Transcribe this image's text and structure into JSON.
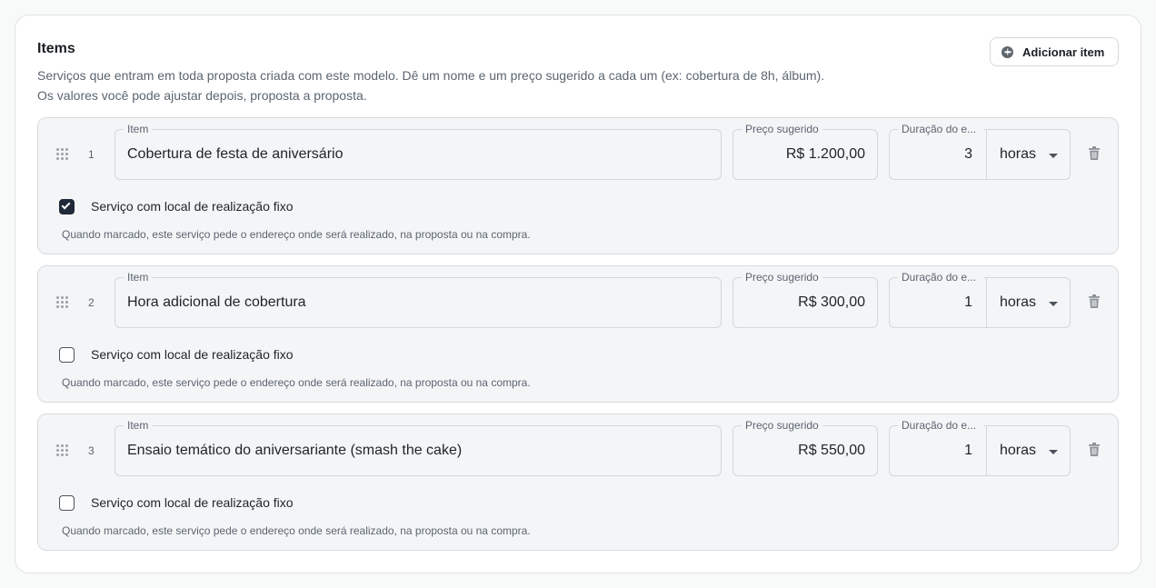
{
  "header": {
    "title": "Items",
    "description_line1": "Serviços que entram em toda proposta criada com este modelo. Dê um nome e um preço sugerido a cada um (ex: cobertura de 8h, álbum).",
    "description_line2": "Os valores você pode ajustar depois, proposta a proposta.",
    "add_button_label": "Adicionar item",
    "add_button_icon": "plus-circle-icon"
  },
  "labels": {
    "item": "Item",
    "price": "Preço sugerido",
    "duration": "Duração do e...",
    "fixed_location": "Serviço com local de realização fixo",
    "fixed_location_hint": "Quando marcado, este serviço pede o endereço onde será realizado, na proposta ou na compra."
  },
  "items": [
    {
      "number": "1",
      "name": "Cobertura de festa de aniversário",
      "price": "R$ 1.200,00",
      "duration": "3",
      "unit": "horas",
      "fixed_location": true
    },
    {
      "number": "2",
      "name": "Hora adicional de cobertura",
      "price": "R$ 300,00",
      "duration": "1",
      "unit": "horas",
      "fixed_location": false
    },
    {
      "number": "3",
      "name": "Ensaio temático do aniversariante (smash the cake)",
      "price": "R$ 550,00",
      "duration": "1",
      "unit": "horas",
      "fixed_location": false
    }
  ],
  "icons": {
    "drag": "drag-handle-icon",
    "delete": "trash-icon",
    "dropdown": "caret-down-icon"
  },
  "colors": {
    "row_bg": "#f4f5f7",
    "checkbox_checked": "#1f2937",
    "muted_text": "#5b6570"
  }
}
